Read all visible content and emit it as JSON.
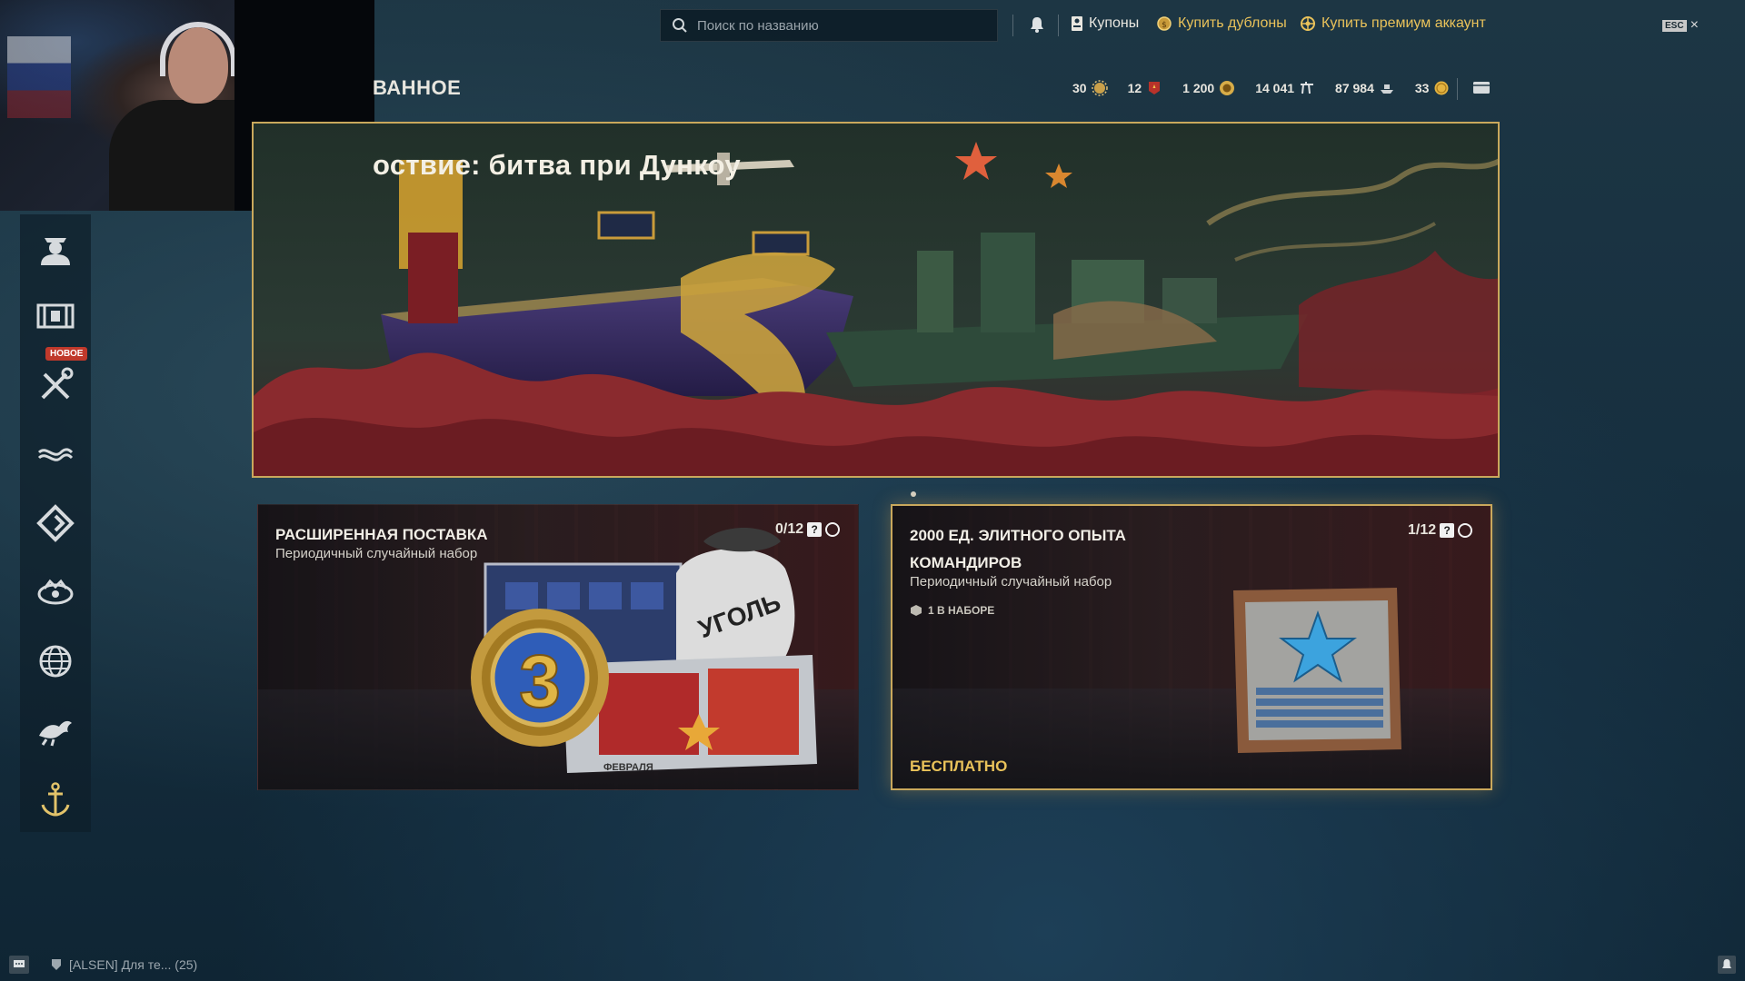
{
  "topbar": {
    "search_placeholder": "Поиск по названию",
    "coupons_label": "Купоны",
    "buy_doubloons_label": "Купить дублоны",
    "buy_premium_label": "Купить премиум аккаунт",
    "esc_label": "ESC",
    "close_glyph": "×"
  },
  "header": {
    "title": "ВАННОЕ"
  },
  "currencies": [
    {
      "value": "30",
      "icon": "sun-token-icon"
    },
    {
      "value": "12",
      "icon": "red-emblem-icon"
    },
    {
      "value": "1 200",
      "icon": "doubloon-icon"
    },
    {
      "value": "14 041",
      "icon": "free-xp-icon"
    },
    {
      "value": "87 984",
      "icon": "ship-xp-icon"
    },
    {
      "value": "33",
      "icon": "coin-icon"
    }
  ],
  "banner": {
    "title": "оствие: битва при Дункоу"
  },
  "sidebar": {
    "items": [
      {
        "name": "commander-icon"
      },
      {
        "name": "containers-icon"
      },
      {
        "name": "tools-icon"
      },
      {
        "name": "camouflage-icon"
      },
      {
        "name": "diamond-arrow-icon"
      },
      {
        "name": "crown-emblem-icon"
      },
      {
        "name": "globe-icon"
      },
      {
        "name": "dragon-icon"
      },
      {
        "name": "anchor-icon"
      }
    ],
    "new_badge": "НОВОЕ"
  },
  "cards": [
    {
      "title": "РАСШИРЕННАЯ ПОСТАВКА",
      "subtitle": "Периодичный случайный набор",
      "count": "0/12"
    },
    {
      "title_line1": "2000 ЕД. ЭЛИТНОГО ОПЫТА",
      "title_line2": "КОМАНДИРОВ",
      "subtitle": "Периодичный случайный набор",
      "in_set": "1 В НАБОРЕ",
      "count": "1/12",
      "price": "БЕСПЛАТНО"
    }
  ],
  "art_text": {
    "bag_label": "УГОЛЬ",
    "medal_number": "3",
    "crate_label": "ФЕВРАЛЯ"
  },
  "bottom": {
    "clan_text": "[ALSEN] Для те... (25)"
  },
  "colors": {
    "accent_gold": "#e9c25a",
    "new_badge": "#c0392b",
    "banner_border": "#c9a85c"
  }
}
